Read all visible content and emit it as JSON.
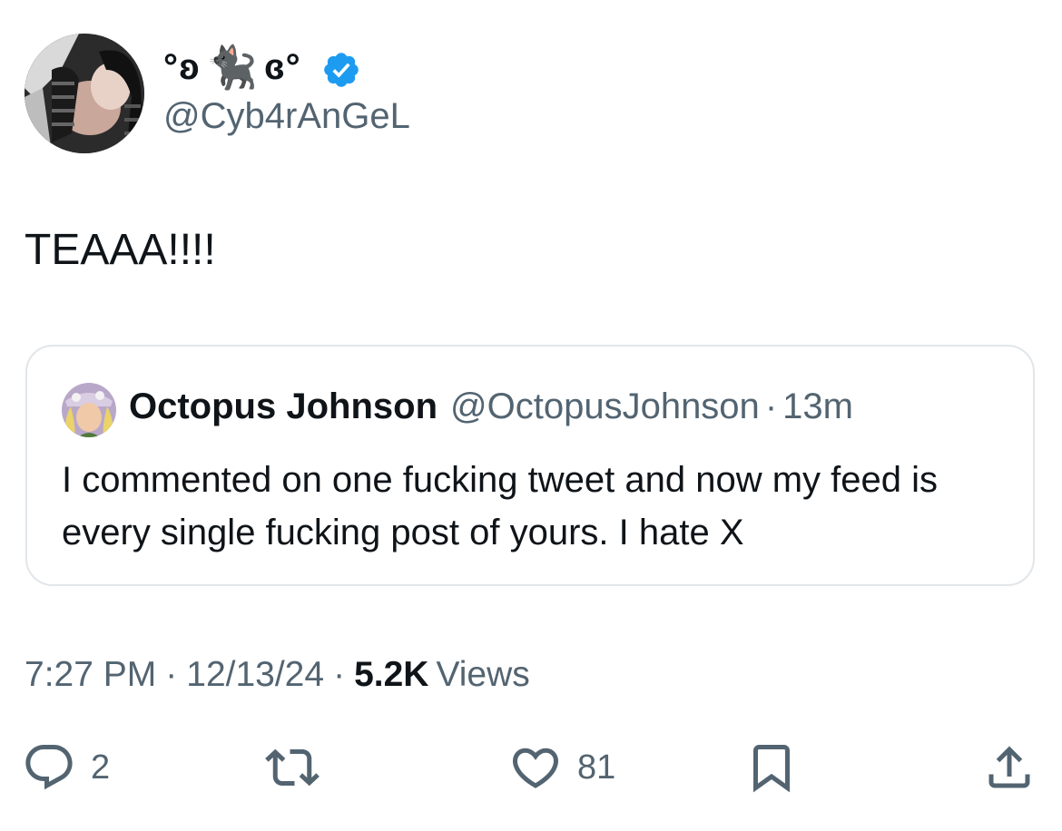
{
  "author": {
    "display_name_left": "°ʚ",
    "display_name_cat": "🐈‍⬛",
    "display_name_right": "ɞ°",
    "handle": "@Cyb4rAnGeL",
    "verified": true
  },
  "tweet": {
    "text": "TEAAA!!!!"
  },
  "quoted": {
    "name": "Octopus Johnson",
    "handle": "@OctopusJohnson",
    "dot": "·",
    "time": "13m",
    "text": "I commented on one fucking tweet and now my feed is every single fucking post of yours. I hate X"
  },
  "meta": {
    "time": "7:27 PM",
    "sep1": "·",
    "date": "12/13/24",
    "sep2": "·",
    "views_count": "5.2K",
    "views_label": "Views"
  },
  "actions": {
    "reply_count": "2",
    "like_count": "81"
  },
  "colors": {
    "text_primary": "#0f1419",
    "text_secondary": "#536471",
    "verified_blue": "#1d9bf0",
    "border": "#e1e6ea"
  },
  "icons": [
    "verified-badge-icon",
    "reply-icon",
    "retweet-icon",
    "like-icon",
    "bookmark-icon",
    "share-icon"
  ]
}
